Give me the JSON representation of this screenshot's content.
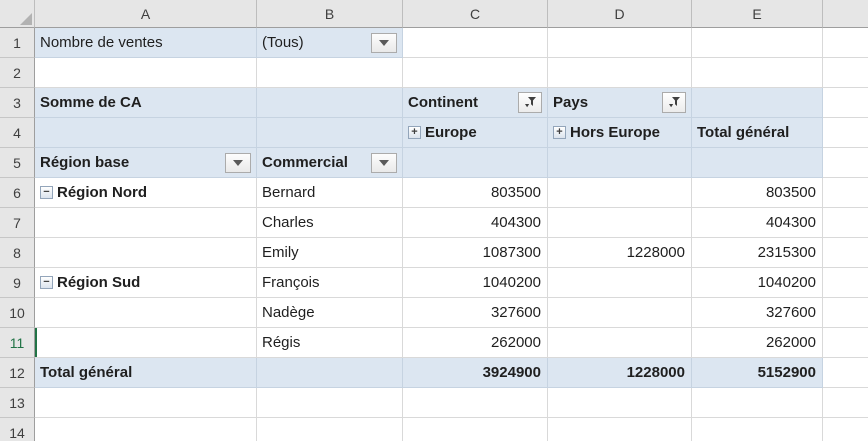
{
  "colors": {
    "pivot_blue": "#dce6f1",
    "active_green": "#217346"
  },
  "icons": {
    "expand_glyph": "+",
    "collapse_glyph": "−"
  },
  "sheet": {
    "column_headers": [
      "A",
      "B",
      "C",
      "D",
      "E"
    ],
    "row_headers": [
      "1",
      "2",
      "3",
      "4",
      "5",
      "6",
      "7",
      "8",
      "9",
      "10",
      "11",
      "12",
      "13",
      "14"
    ]
  },
  "page_filter": {
    "field": "Nombre de ventes",
    "value": "(Tous)"
  },
  "pivot": {
    "value_label": "Somme de CA",
    "column_fields": [
      {
        "name": "Continent"
      },
      {
        "name": "Pays"
      }
    ],
    "column_groups": [
      {
        "label": "Europe"
      },
      {
        "label": "Hors Europe"
      }
    ],
    "grand_total_column": "Total général",
    "row_field": "Région base",
    "row_field2": "Commercial",
    "rows": [
      {
        "region": "Région Nord",
        "commercial": "Bernard",
        "europe": "803500",
        "hors_europe": "",
        "total": "803500"
      },
      {
        "region": "",
        "commercial": "Charles",
        "europe": "404300",
        "hors_europe": "",
        "total": "404300"
      },
      {
        "region": "",
        "commercial": "Emily",
        "europe": "1087300",
        "hors_europe": "1228000",
        "total": "2315300"
      },
      {
        "region": "Région Sud",
        "commercial": "François",
        "europe": "1040200",
        "hors_europe": "",
        "total": "1040200"
      },
      {
        "region": "",
        "commercial": "Nadège",
        "europe": "327600",
        "hors_europe": "",
        "total": "327600"
      },
      {
        "region": "",
        "commercial": "Régis",
        "europe": "262000",
        "hors_europe": "",
        "total": "262000"
      }
    ],
    "grand_total": {
      "label": "Total général",
      "europe": "3924900",
      "hors_europe": "1228000",
      "total": "5152900"
    }
  },
  "selection": {
    "active_row_header": "11"
  }
}
